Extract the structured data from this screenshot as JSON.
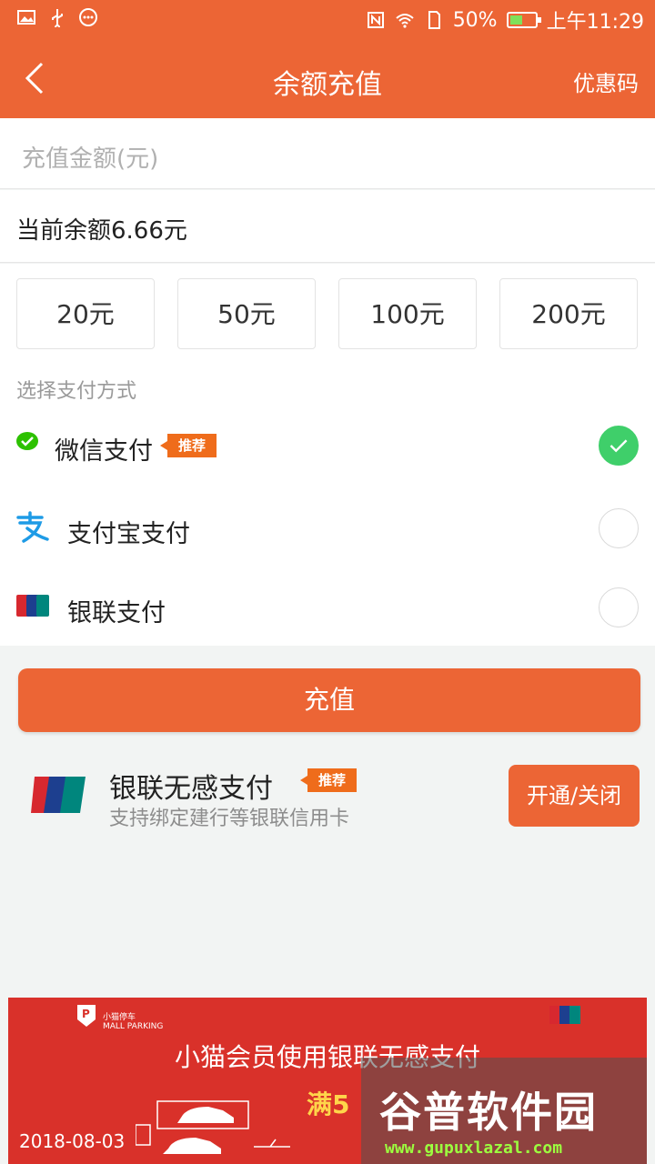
{
  "status_bar": {
    "battery_percent": "50%",
    "time": "上午11:29",
    "left_icons": [
      "image-icon",
      "usb-icon",
      "more-icon"
    ],
    "right_icons": [
      "nfc-icon",
      "wifi-icon",
      "sim-icon",
      "battery-icon"
    ],
    "battery_level": 0.5
  },
  "header": {
    "title": "余额充值",
    "coupon_label": "优惠码",
    "background": "#ec6535"
  },
  "form": {
    "amount_placeholder": "充值金额(元)",
    "balance_text": "当前余额6.66元"
  },
  "amount_options": [
    "20元",
    "50元",
    "100元",
    "200元"
  ],
  "payment": {
    "section_label": "选择支付方式",
    "methods": [
      {
        "name": "微信支付",
        "tag": "推荐",
        "icon": "wechat-icon",
        "selected": true
      },
      {
        "name": "支付宝支付",
        "icon": "alipay-icon",
        "selected": false
      },
      {
        "name": "银联支付",
        "icon": "unionpay-icon",
        "selected": false
      }
    ]
  },
  "recharge_button": "充值",
  "unionpay_promo": {
    "title": "银联无感支付",
    "tag": "推荐",
    "subtitle": "支持绑定建行等银联信用卡",
    "button": "开通/关闭"
  },
  "banner": {
    "brand": "小猫停车",
    "brand_sub": "MALL PARKING",
    "headline": "小猫会员使用银联无感支付",
    "promo_prefix": "满5",
    "date": "2018-08-03",
    "watermark_main": "谷普软件园",
    "watermark_url": "www.gupuxlazal.com"
  },
  "colors": {
    "accent": "#ec6535",
    "tag": "#ef6c1b",
    "check": "#3fcf6a",
    "banner": "#d9312a"
  }
}
